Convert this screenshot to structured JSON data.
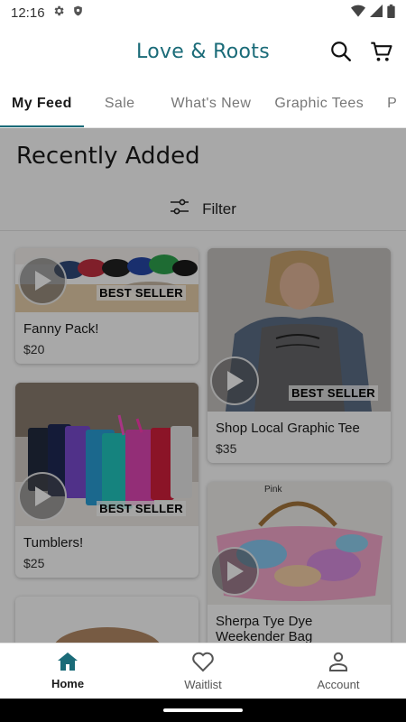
{
  "status_bar": {
    "time": "12:16"
  },
  "header": {
    "title": "Love & Roots"
  },
  "tabs": [
    {
      "label": "My Feed",
      "active": true
    },
    {
      "label": "Sale",
      "active": false
    },
    {
      "label": "What's New",
      "active": false
    },
    {
      "label": "Graphic Tees",
      "active": false
    },
    {
      "label": "P",
      "active": false
    }
  ],
  "feed": {
    "section_title": "Recently Added",
    "filter_label": "Filter",
    "products": [
      {
        "name": "Fanny Pack!",
        "price": "$20",
        "badge": "BEST SELLER"
      },
      {
        "name": "Shop Local Graphic Tee",
        "price": "$35",
        "badge": "BEST SELLER"
      },
      {
        "name": "Tumblers!",
        "price": "$25",
        "badge": "BEST SELLER"
      },
      {
        "name": "Sherpa Tye Dye Weekender Bag",
        "price": "",
        "badge": "",
        "image_text": "Pink"
      }
    ]
  },
  "bottom_nav": [
    {
      "label": "Home",
      "icon": "home-icon",
      "active": true
    },
    {
      "label": "Waitlist",
      "icon": "heart-icon",
      "active": false
    },
    {
      "label": "Account",
      "icon": "person-icon",
      "active": false
    }
  ],
  "colors": {
    "brand": "#1a6b78",
    "text": "#1a1a1a",
    "muted": "#777777"
  }
}
